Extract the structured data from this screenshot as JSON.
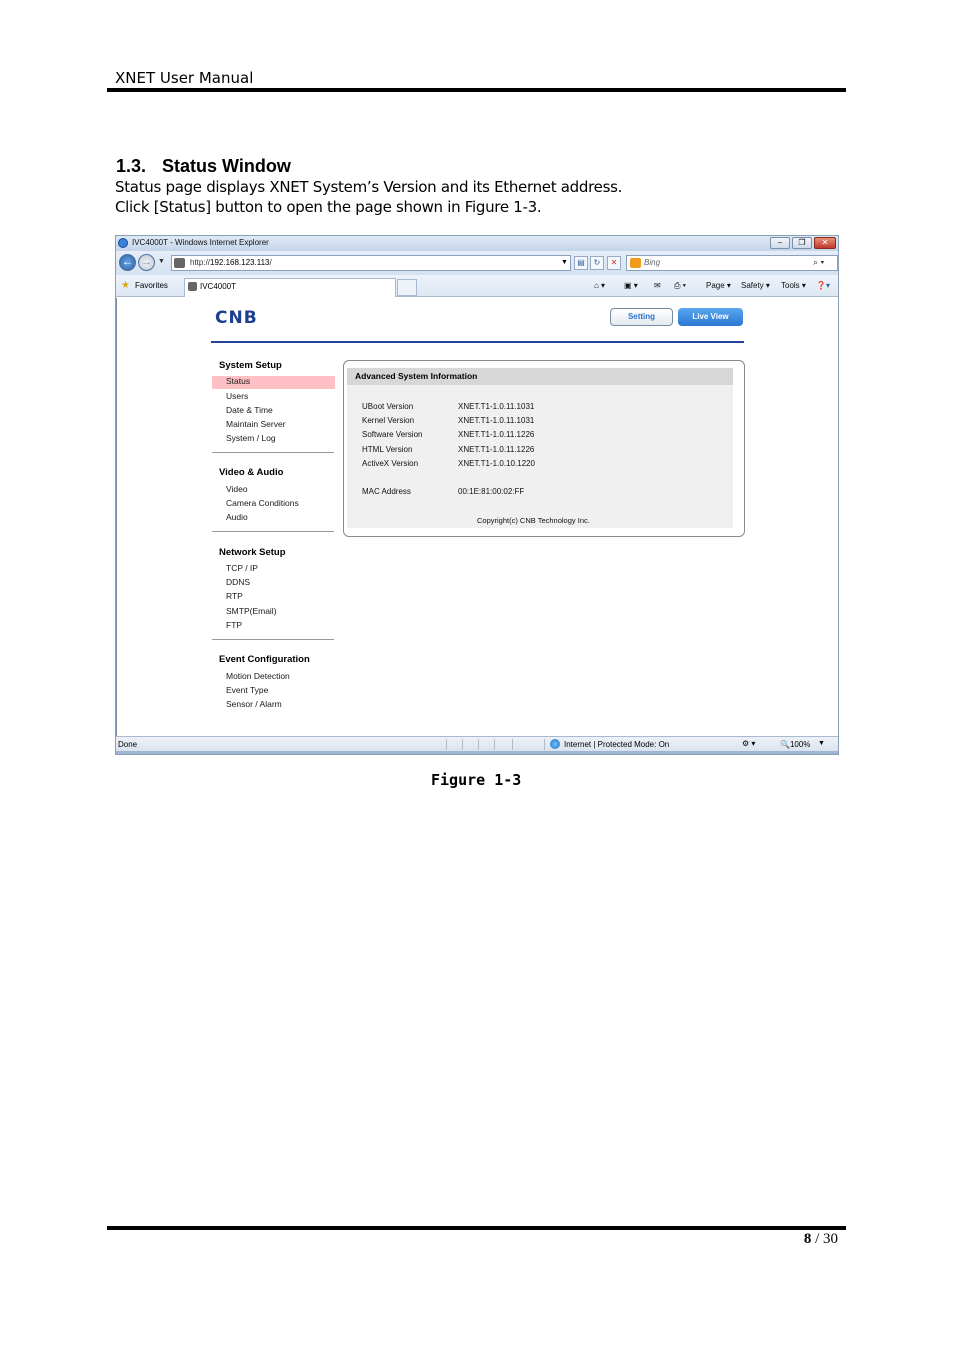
{
  "header": {
    "title": "XNET User Manual"
  },
  "section": {
    "number": "1.3.",
    "title": "Status Window",
    "para1": "Status page displays XNET System’s Version and its Ethernet address.",
    "para2": "Click [Status] button to open the page shown in Figure 1-3."
  },
  "browser": {
    "window_title": "IVC4000T - Windows Internet Explorer",
    "url_prefix": "http://",
    "url_host": "192.168.123.113",
    "url_suffix": "/",
    "search_placeholder": "Bing",
    "favorites_label": "Favorites",
    "tab_label": "IVC4000T",
    "commands": [
      "Page ▾",
      "Safety ▾",
      "Tools ▾"
    ],
    "status_left": "Done",
    "status_zone": "Internet | Protected Mode: On",
    "zoom": "🔍100%"
  },
  "app": {
    "logo": "CNB",
    "setting_button": "Setting",
    "liveview_button": "Live View",
    "sidebar": [
      {
        "heading": "System Setup",
        "items": [
          "Status",
          "Users",
          "Date & Time",
          "Maintain Server",
          "System / Log"
        ]
      },
      {
        "heading": "Video & Audio",
        "items": [
          "Video",
          "Camera Conditions",
          "Audio"
        ]
      },
      {
        "heading": "Network Setup",
        "items": [
          "TCP / IP",
          "DDNS",
          "RTP",
          "SMTP(Email)",
          "FTP"
        ]
      },
      {
        "heading": "Event Configuration",
        "items": [
          "Motion Detection",
          "Event Type",
          "Sensor / Alarm"
        ]
      }
    ],
    "panel_title": "Advanced System Information",
    "info": [
      {
        "label": "UBoot Version",
        "value": "XNET.T1-1.0.11.1031"
      },
      {
        "label": "Kernel Version",
        "value": "XNET.T1-1.0.11.1031"
      },
      {
        "label": "Software Version",
        "value": "XNET.T1-1.0.11.1226"
      },
      {
        "label": "HTML Version",
        "value": "XNET.T1-1.0.11.1226"
      },
      {
        "label": "ActiveX Version",
        "value": "XNET.T1-1.0.10.1220"
      }
    ],
    "mac_label": "MAC Address",
    "mac_value": "00:1E:81:00:02:FF",
    "copyright": "Copyright(c) CNB Technology Inc."
  },
  "caption": "Figure 1-3",
  "footer": {
    "page_current": "8",
    "page_sep": " / ",
    "page_total": "30"
  }
}
